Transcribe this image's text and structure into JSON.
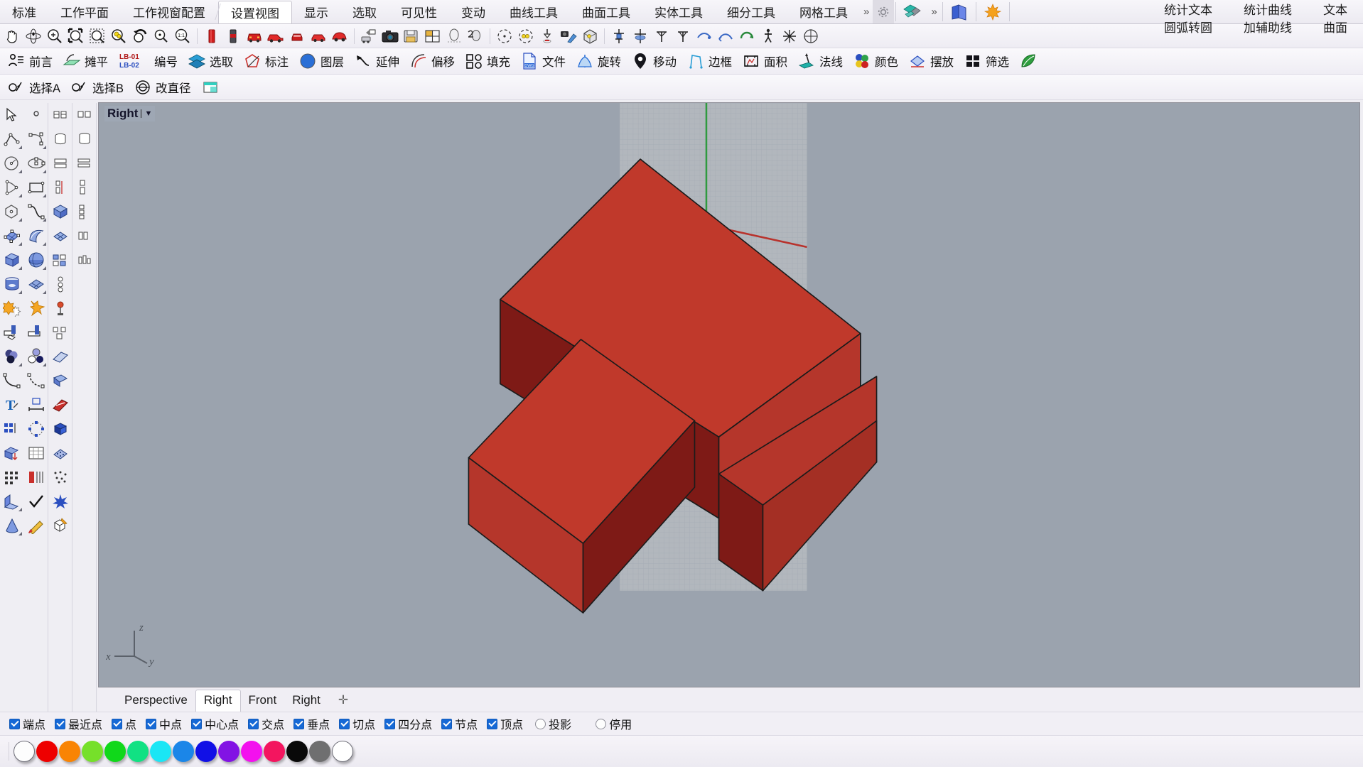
{
  "app": {
    "title": "Rhinoceros 3D - Right viewport"
  },
  "menu": {
    "tabs": [
      {
        "label": "标准",
        "active": false
      },
      {
        "label": "工作平面",
        "active": false
      },
      {
        "label": "工作视窗配置",
        "active": false
      },
      {
        "label": "设置视图",
        "active": true
      },
      {
        "label": "显示",
        "active": false
      },
      {
        "label": "选取",
        "active": false
      },
      {
        "label": "可见性",
        "active": false
      },
      {
        "label": "变动",
        "active": false
      },
      {
        "label": "曲线工具",
        "active": false
      },
      {
        "label": "曲面工具",
        "active": false
      },
      {
        "label": "实体工具",
        "active": false
      },
      {
        "label": "细分工具",
        "active": false
      },
      {
        "label": "网格工具",
        "active": false
      }
    ],
    "overflow_label": "»",
    "overflow_label2": "»",
    "gear_icon": "gear-icon",
    "plugin_icon": "teal-solid-icon",
    "book_icon": "blue-book-icon",
    "maple_icon": "maple-leaf-icon",
    "right_rows": [
      {
        "items": [
          "统计文本",
          "统计曲线",
          "文本"
        ]
      },
      {
        "items": [
          "圆弧转圆",
          "加辅助线",
          "曲面"
        ]
      }
    ]
  },
  "icon_toolbar": {
    "groups": [
      [
        "pan-hand-icon",
        "rotate-view-icon",
        "zoom-icon",
        "zoom-window-icon",
        "zoom-selected-icon",
        "zoom-extents-icon",
        "undo-view-icon",
        "zoom-target-icon",
        "zoom-1to1-icon"
      ],
      [
        "red-can-icon",
        "dark-cylinder-icon",
        "red-car-front-icon",
        "red-car-side-icon",
        "red-car-small-icon",
        "red-car-tiny-icon",
        "red-car-3d-icon"
      ],
      [
        "camera-place-icon",
        "camera-icon",
        "save-view-icon",
        "tile-views-icon",
        "shade-icon",
        "render-preview-icon"
      ],
      [
        "target-icon",
        "target-color-icon",
        "drop-arrow-icon",
        "camera-plane-icon",
        "bounding-box-icon"
      ],
      [
        "named-cplane-icon",
        "cplane-origin-icon",
        "cplane-top-icon",
        "cplane-front-icon",
        "cplane-right-icon",
        "cplane-curve-icon",
        "rotate-cplane-icon",
        "walk-icon",
        "explode-view-icon",
        "circle-grid-icon"
      ]
    ]
  },
  "toolbar_row2": [
    {
      "label": "前言",
      "icon": "person-list-icon"
    },
    {
      "label": "摊平",
      "icon": "unroll-icon"
    },
    {
      "label": "编号",
      "icon": "lb-number-icon",
      "badge_top": "LB-01",
      "badge_bottom": "LB-02"
    },
    {
      "label": "选取",
      "icon": "layers-select-icon"
    },
    {
      "label": "标注",
      "icon": "annotate-icon"
    },
    {
      "label": "图层",
      "icon": "layer-globe-icon"
    },
    {
      "label": "延伸",
      "icon": "extend-icon"
    },
    {
      "label": "偏移",
      "icon": "offset-icon"
    },
    {
      "label": "填充",
      "icon": "fill-icon"
    },
    {
      "label": "文件",
      "icon": "dwg-file-icon"
    },
    {
      "label": "旋转",
      "icon": "rotate-icon"
    },
    {
      "label": "移动",
      "icon": "move-pin-icon"
    },
    {
      "label": "边框",
      "icon": "border-icon"
    },
    {
      "label": "面积",
      "icon": "area-icon"
    },
    {
      "label": "法线",
      "icon": "normal-icon"
    },
    {
      "label": "颜色",
      "icon": "color-dots-icon"
    },
    {
      "label": "摆放",
      "icon": "place-icon"
    },
    {
      "label": "筛选",
      "icon": "filter-icon"
    }
  ],
  "toolbar_row3": [
    {
      "label": "选择A",
      "icon": "select-a-icon"
    },
    {
      "label": "选择B",
      "icon": "select-b-icon"
    },
    {
      "label": "改直径",
      "icon": "change-diameter-icon"
    },
    {
      "label": "",
      "icon": "window-green-icon"
    }
  ],
  "left_tools": {
    "col1": [
      "arrow-select-icon",
      "polyline-icon",
      "circle-icon",
      "triangle-curve-icon",
      "polygon-icon",
      "surface-grid-icon",
      "box-icon",
      "cylinder-icon",
      "boolean-star-icon",
      "split-icon",
      "sphere-group-icon",
      "fillet-curve-icon",
      "text-icon",
      "array-grid-icon",
      "solid-edit-icon",
      "dot-grid-icon",
      "wedge-icon",
      "cone-icon"
    ],
    "col2": [
      "point-icon",
      "arc-icon",
      "ellipse-icon",
      "rectangle-icon",
      "curve-icon",
      "sweep-icon",
      "sphere-icon",
      "mesh-plane-icon",
      "explode-icon",
      "trim-icon",
      "circle-dots-icon",
      "blend-curve-icon",
      "dim-icon",
      "array-polar-icon",
      "chart-icon",
      "scatter-icon",
      "check-icon",
      "paint-icon"
    ],
    "col3": [
      "mesh-box-icon",
      "mesh-cylinder-icon",
      "mesh-plane2-icon",
      "mesh-extrude-icon",
      "mesh-cube-icon",
      "mesh-quad-icon",
      "mesh-bump-icon",
      "mesh-array-icon",
      "mesh-patch-icon",
      "mesh-sphere-icon",
      "mesh-line-icon",
      "mesh-blob-icon",
      "mesh-stripe-icon",
      "mesh-cube2-icon",
      "mesh-points-icon",
      "mesh-dots-icon",
      "mesh-star-icon",
      "mesh-cube-pencil-icon"
    ],
    "col4": [
      "grid-sm-icon",
      "grid-sm2-icon",
      "grid-sm3-icon",
      "grid-sm4-icon",
      "grid-sm5-icon",
      "grid-sm6-icon",
      "grid-sm7-icon"
    ]
  },
  "viewport": {
    "label": "Right",
    "dropdown_caret": "▼",
    "background_color": "#9ba3ae",
    "grid_plane_color": "#b0b5bb",
    "object_color": "#c0392b",
    "object_shadow_color": "#7e1a16",
    "axis": {
      "x": "x",
      "y": "y",
      "z": "z",
      "axis_color": "#555b63"
    },
    "cplane_x_axis_color": "#c0392b",
    "cplane_y_axis_color": "#2a9b3e",
    "tabs": [
      {
        "label": "Perspective",
        "active": false
      },
      {
        "label": "Right",
        "active": true
      },
      {
        "label": "Front",
        "active": false
      },
      {
        "label": "Right",
        "active": false
      }
    ],
    "add_tab": "✛"
  },
  "osnap": {
    "items": [
      {
        "label": "端点",
        "checked": true
      },
      {
        "label": "最近点",
        "checked": true
      },
      {
        "label": "点",
        "checked": true
      },
      {
        "label": "中点",
        "checked": true
      },
      {
        "label": "中心点",
        "checked": true
      },
      {
        "label": "交点",
        "checked": true
      },
      {
        "label": "垂点",
        "checked": true
      },
      {
        "label": "切点",
        "checked": true
      },
      {
        "label": "四分点",
        "checked": true
      },
      {
        "label": "节点",
        "checked": true
      },
      {
        "label": "顶点",
        "checked": true
      },
      {
        "label": "投影",
        "checked": false
      },
      {
        "label": "停用",
        "checked": false
      }
    ]
  },
  "colors": {
    "swatches": [
      {
        "name": "no-color",
        "hex": "#fdfdfd",
        "outline": true
      },
      {
        "name": "red",
        "hex": "#ee0000"
      },
      {
        "name": "orange",
        "hex": "#f98404"
      },
      {
        "name": "yellow-green",
        "hex": "#76e02a"
      },
      {
        "name": "green",
        "hex": "#10d81a"
      },
      {
        "name": "spring-green",
        "hex": "#11e183"
      },
      {
        "name": "cyan",
        "hex": "#1ae6f5"
      },
      {
        "name": "azure",
        "hex": "#1b86e8"
      },
      {
        "name": "blue",
        "hex": "#1110e6"
      },
      {
        "name": "violet",
        "hex": "#8213e4"
      },
      {
        "name": "magenta",
        "hex": "#f311ee"
      },
      {
        "name": "pink",
        "hex": "#f3155f"
      },
      {
        "name": "black",
        "hex": "#090909"
      },
      {
        "name": "gray",
        "hex": "#6f6f70"
      },
      {
        "name": "white",
        "hex": "#ffffff",
        "outline": true
      }
    ]
  }
}
